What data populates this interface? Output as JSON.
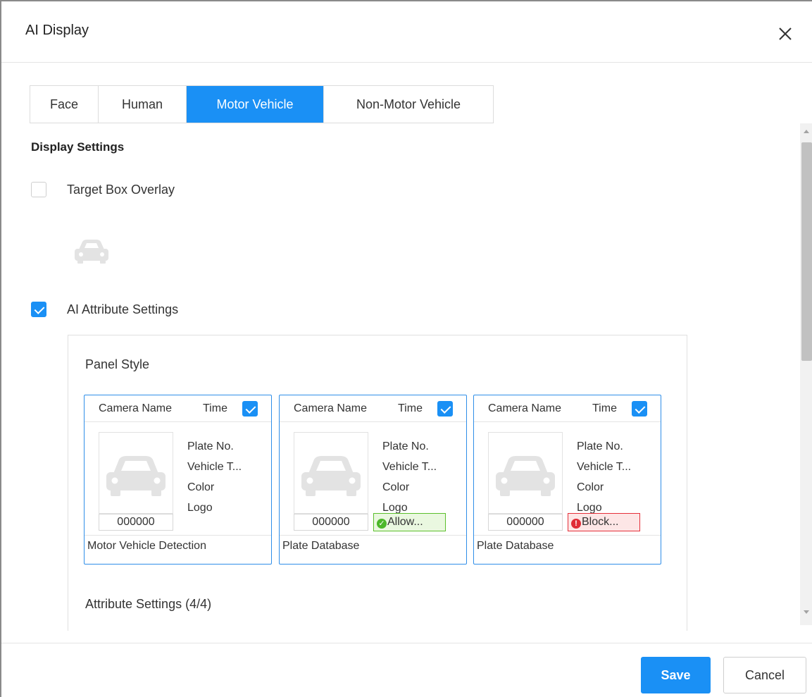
{
  "dialog": {
    "title": "AI Display",
    "close_label": "X"
  },
  "tabs": [
    {
      "label": "Face",
      "active": false
    },
    {
      "label": "Human",
      "active": false
    },
    {
      "label": "Motor Vehicle",
      "active": true
    },
    {
      "label": "Non-Motor Vehicle",
      "active": false
    }
  ],
  "display_settings": {
    "title": "Display Settings",
    "target_box_overlay": {
      "label": "Target Box Overlay",
      "checked": false
    },
    "ai_attribute_settings": {
      "label": "AI Attribute Settings",
      "checked": true
    }
  },
  "panel_style": {
    "label": "Panel Style",
    "cards": [
      {
        "camera_name": "Camera Name",
        "time_label": "Time",
        "time_checked": true,
        "attributes": [
          "Plate No.",
          "Vehicle T...",
          "Color",
          "Logo"
        ],
        "plate": "000000",
        "badge": "",
        "footer": "Motor Vehicle Detection"
      },
      {
        "camera_name": "Camera Name",
        "time_label": "Time",
        "time_checked": true,
        "attributes": [
          "Plate No.",
          "Vehicle T...",
          "Color",
          "Logo"
        ],
        "plate": "000000",
        "badge": "Allow...",
        "footer": "Plate Database"
      },
      {
        "camera_name": "Camera Name",
        "time_label": "Time",
        "time_checked": true,
        "attributes": [
          "Plate No.",
          "Vehicle T...",
          "Color",
          "Logo"
        ],
        "plate": "000000",
        "badge": "Block...",
        "footer": "Plate Database"
      }
    ]
  },
  "attribute_settings": {
    "label": "Attribute Settings (4/4)"
  },
  "buttons": {
    "save": "Save",
    "cancel": "Cancel"
  },
  "colors": {
    "accent": "#1a90f5",
    "allow": "#4cb82a",
    "block": "#e02b36"
  },
  "icons": {
    "close": "close-icon",
    "car": "car-icon",
    "checkmark": "checkmark-icon"
  }
}
